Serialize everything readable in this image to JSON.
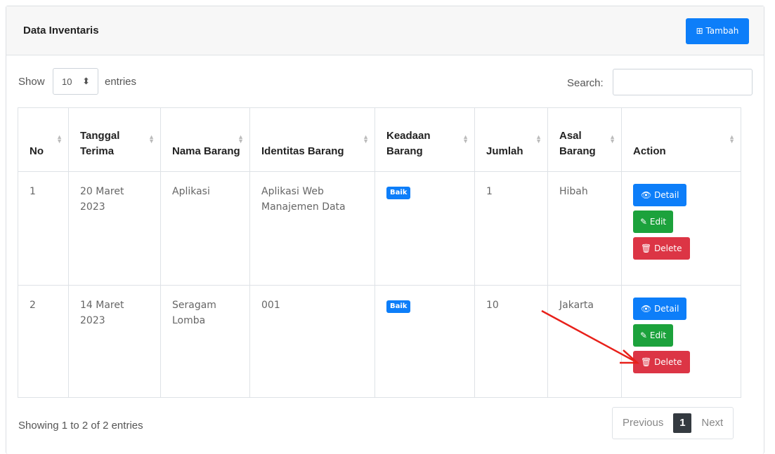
{
  "header": {
    "title": "Data Inventaris",
    "add_label": "Tambah",
    "add_icon": "plus-square-icon"
  },
  "controls": {
    "show_label": "Show",
    "page_length": "10",
    "entries_label": "entries",
    "search_label": "Search:",
    "search_value": ""
  },
  "table": {
    "headers": [
      "No",
      "Tanggal Terima",
      "Nama Barang",
      "Identitas Barang",
      "Keadaan Barang",
      "Jumlah",
      "Asal Barang",
      "Action"
    ],
    "rows": [
      {
        "no": "1",
        "tanggal": "20 Maret 2023",
        "nama": "Aplikasi",
        "identitas": "Aplikasi Web Manajemen Data",
        "keadaan": "Baik",
        "jumlah": "1",
        "asal": "Hibah"
      },
      {
        "no": "2",
        "tanggal": "14 Maret 2023",
        "nama": "Seragam Lomba",
        "identitas": "001",
        "keadaan": "Baik",
        "jumlah": "10",
        "asal": "Jakarta"
      }
    ],
    "actions": {
      "detail": "Detail",
      "edit": "Edit",
      "delete": "Delete"
    }
  },
  "footer": {
    "info": "Showing 1 to 2 of 2 entries",
    "prev": "Previous",
    "page": "1",
    "next": "Next"
  },
  "colors": {
    "primary": "#0d7ef9",
    "success": "#1ca23c",
    "danger": "#dc3545",
    "annotation_arrow": "#e8201a"
  }
}
